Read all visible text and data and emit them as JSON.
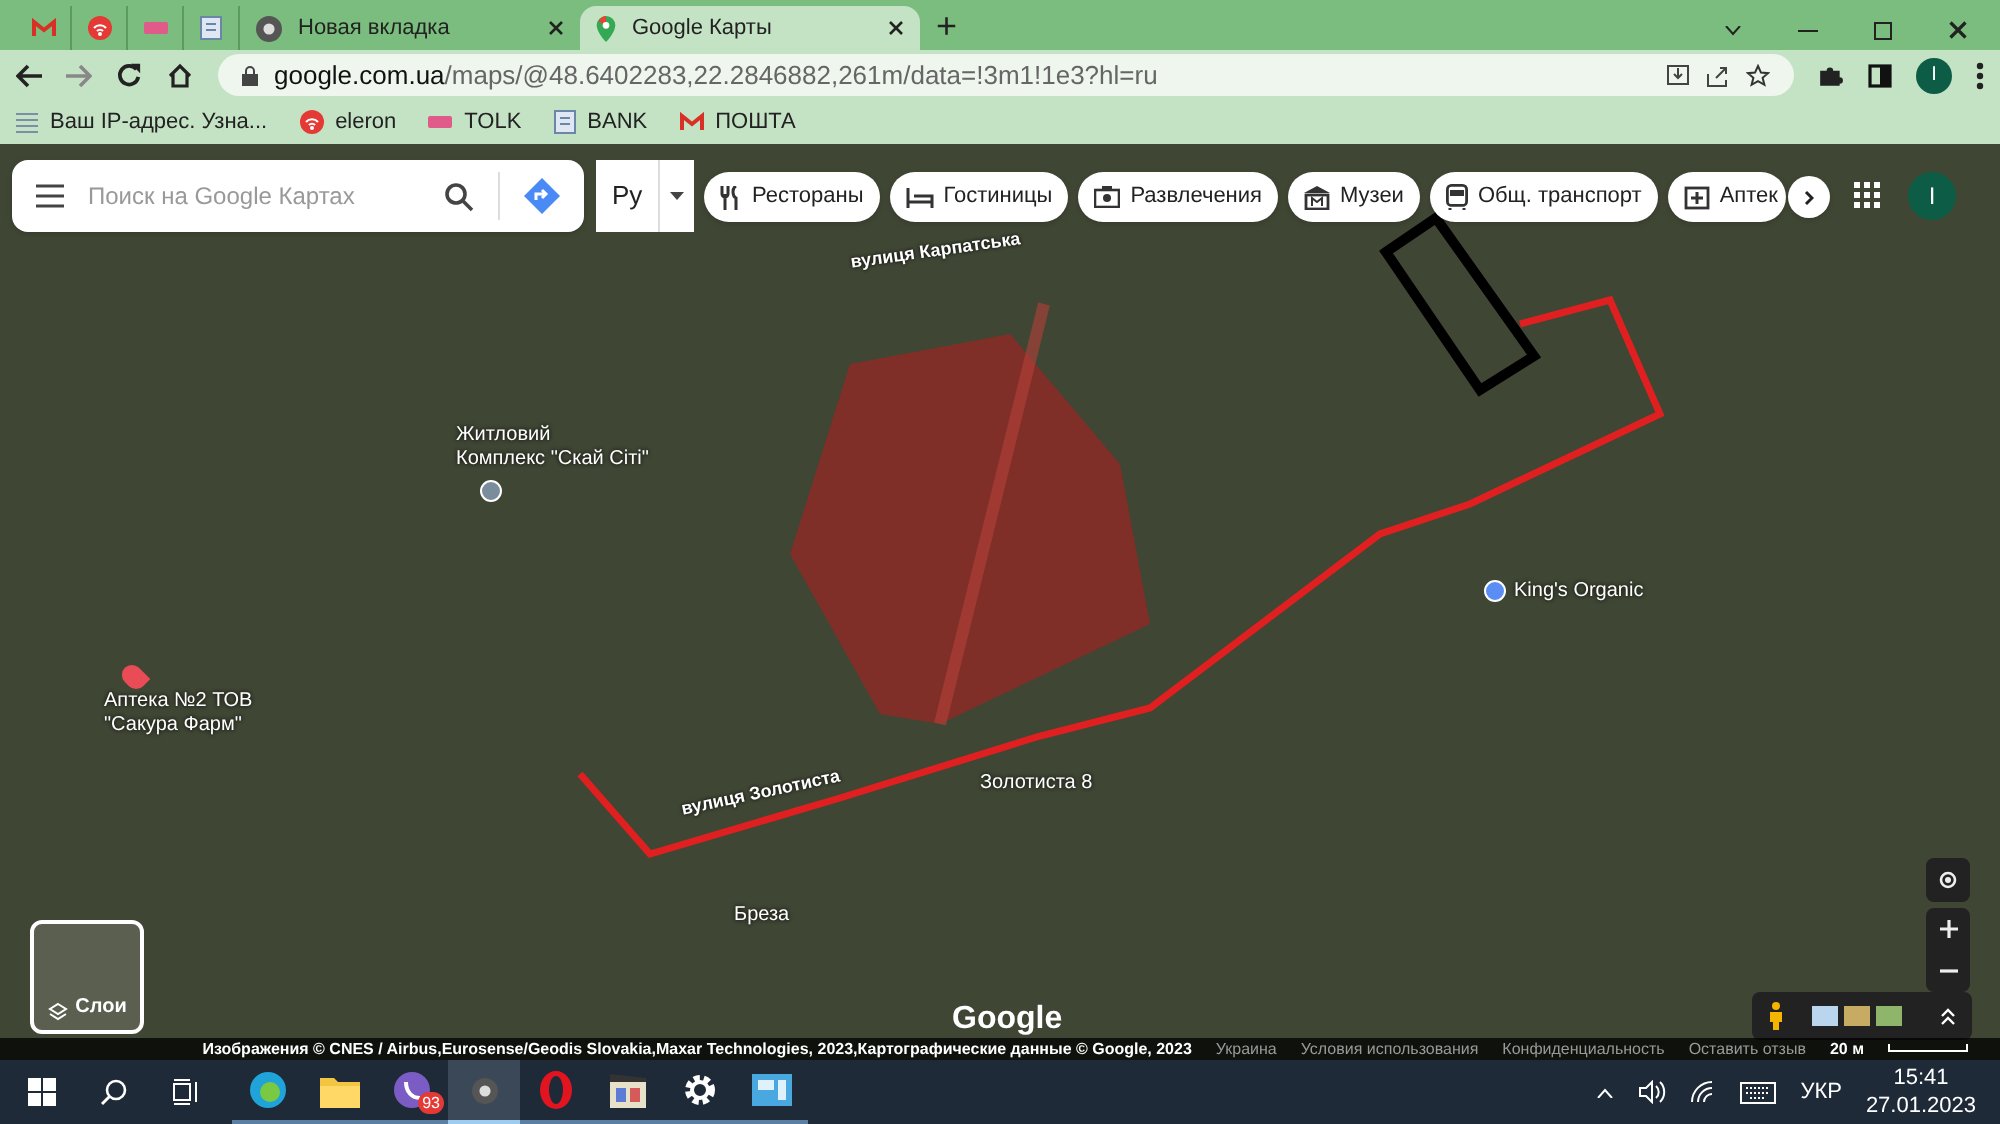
{
  "tabs": [
    {
      "kind": "pinned",
      "selected": false
    },
    {
      "kind": "pinned",
      "selected": false
    },
    {
      "kind": "pinned",
      "selected": false
    },
    {
      "kind": "pinned",
      "selected": false
    },
    {
      "kind": "titled",
      "title": "Новая вкладка",
      "selected": false
    },
    {
      "kind": "titled",
      "title": "Google Карты",
      "selected": true
    }
  ],
  "new_tab": "+",
  "address": {
    "host": "google.com.ua",
    "path": "/maps/@48.6402283,22.2846882,261m/data=!3m1!1e3?hl=ru"
  },
  "profile_initial": "I",
  "bookmarks": [
    "Ваш IP-адрес. Узна...",
    "eleron",
    "TOLK",
    "BANK",
    "ПОШТА"
  ],
  "maps": {
    "search": {
      "placeholder": "Поиск на Google Картах"
    },
    "language": "Ру",
    "categories": [
      "Рестораны",
      "Гостиницы",
      "Развлечения",
      "Музеи",
      "Общ. транспорт",
      "Аптек"
    ],
    "account_initial": "I",
    "labels": [
      {
        "kind": "street",
        "text": "вулиця Карпатська"
      },
      {
        "kind": "poi",
        "text": "Житловий\nКомплекс \"Скай Сіті\""
      },
      {
        "kind": "shop",
        "text": "King's Organic"
      },
      {
        "kind": "pin",
        "text": "Аптека №2 ТОВ\n\"Сакура Фарм\""
      },
      {
        "kind": "street",
        "text": "вулиця Золотиста"
      },
      {
        "kind": "address",
        "text": "Золотиста 8"
      },
      {
        "kind": "address",
        "text": "Бреза"
      }
    ],
    "layers": "Слои",
    "logo": "Google",
    "footer": [
      {
        "kind": "strong",
        "text": "Изображения © CNES / Airbus,Eurosense/Geodis Slovakia,Maxar Technologies, 2023,Картографические данные © Google, 2023"
      },
      {
        "kind": "link",
        "text": "Украина"
      },
      {
        "kind": "link",
        "text": "Условия использования"
      },
      {
        "kind": "link",
        "text": "Конфиденциальность"
      },
      {
        "kind": "link",
        "text": "Оставить отзыв"
      },
      {
        "kind": "strong",
        "text": "20 м"
      }
    ]
  },
  "taskbar": {
    "apps": [
      {
        "active": false
      },
      {
        "active": false
      },
      {
        "active": false,
        "badge": "93"
      },
      {
        "active": true
      },
      {
        "active": false
      },
      {
        "active": false
      },
      {
        "active": false
      },
      {
        "active": false
      }
    ],
    "language": "УКР",
    "time": "15:41",
    "date": "27.01.2023"
  }
}
